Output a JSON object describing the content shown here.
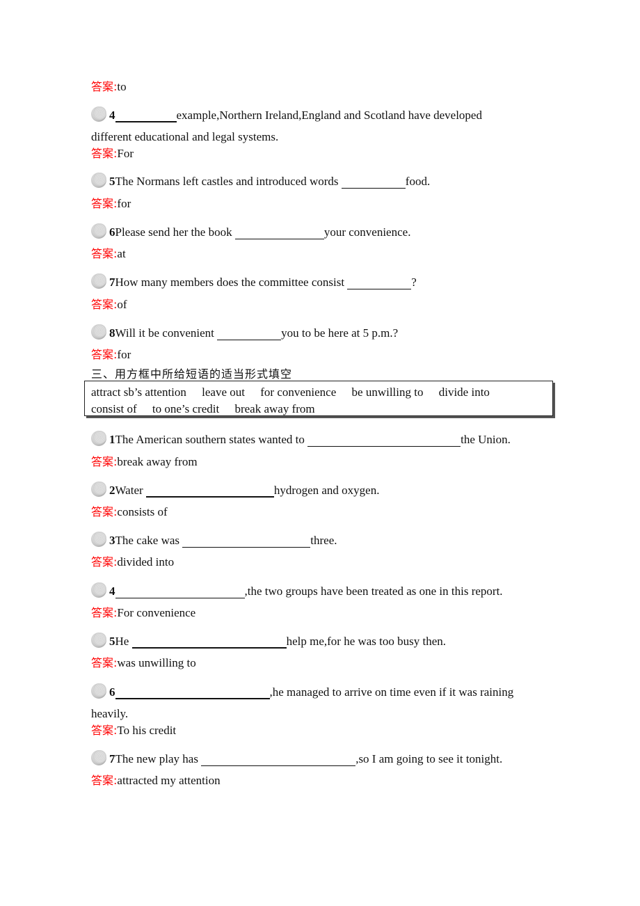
{
  "answer_label": "答案:",
  "part2_tail": {
    "prev_answer": "to",
    "questions": [
      {
        "num": "4",
        "before": "",
        "after": " example,Northern Ireland,England and Scotland have developed",
        "continuation": "different educational and legal systems.",
        "answer": "For"
      },
      {
        "num": "5",
        "before": "The Normans left castles and introduced words ",
        "after": "food.",
        "answer": "for"
      },
      {
        "num": "6",
        "before": "Please send her the book ",
        "after": "your convenience.",
        "answer": "at"
      },
      {
        "num": "7",
        "before": "How many members does the committee consist ",
        "after": "?",
        "answer": "of"
      },
      {
        "num": "8",
        "before": "Will it be convenient ",
        "after": "you to be here at 5 p.m.?",
        "answer": "for"
      }
    ]
  },
  "section3": {
    "title": "三、用方框中所给短语的适当形式填空",
    "phrase_rows": [
      [
        "attract sb’s attention",
        "leave out",
        "for convenience",
        "be unwilling to",
        "divide into"
      ],
      [
        "consist of",
        "to one’s credit",
        "break away from"
      ]
    ],
    "questions": [
      {
        "num": "1",
        "before": "The American southern states wanted to ",
        "after": "the Union.",
        "answer": "break away from"
      },
      {
        "num": "2",
        "before": "Water ",
        "after": "hydrogen and oxygen.",
        "answer": "consists of"
      },
      {
        "num": "3",
        "before": "The cake was ",
        "after": "three.",
        "answer": "divided into"
      },
      {
        "num": "4",
        "before": "",
        "after": ",the two groups have been treated as one in this report.",
        "answer": "For convenience"
      },
      {
        "num": "5",
        "before": "He ",
        "after": "help me,for he was too busy then.",
        "answer": "was unwilling to"
      },
      {
        "num": "6",
        "before": "",
        "after": ",he managed to arrive on time even if it was raining",
        "continuation": "heavily.",
        "answer": "To his credit"
      },
      {
        "num": "7",
        "before": "The new play has ",
        "after": ",so I am going to see it tonight.",
        "answer": "attracted my attention"
      }
    ]
  }
}
